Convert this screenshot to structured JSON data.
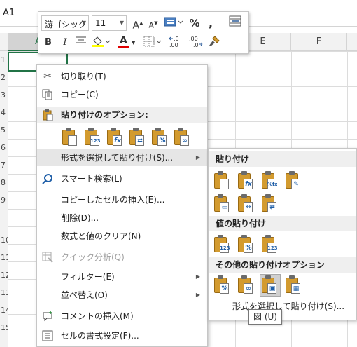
{
  "spreadsheet": {
    "name_box": "A1",
    "columns": [
      "A",
      "B",
      "C",
      "D",
      "E",
      "F"
    ],
    "rows": [
      "1",
      "2",
      "3",
      "4",
      "5",
      "6",
      "7",
      "8",
      "9",
      "10",
      "11",
      "12",
      "13",
      "14",
      "15"
    ]
  },
  "mini_toolbar": {
    "font_name": "游ゴシック",
    "font_size": "11",
    "increase_font": "A",
    "decrease_font": "A",
    "percent": "%",
    "comma": ",",
    "bold": "B",
    "italic": "I",
    "font_color_letter": "A"
  },
  "context_menu": {
    "items": [
      {
        "label": "切り取り(T)",
        "icon": "scissors-icon"
      },
      {
        "label": "コピー(C)",
        "icon": "copy-icon"
      },
      {
        "label": "貼り付けのオプション:",
        "icon": "paste-icon"
      },
      {
        "label": "形式を選択して貼り付け(S)...",
        "icon": "none"
      },
      {
        "label": "スマート検索(L)",
        "icon": "search-icon"
      },
      {
        "label": "コピーしたセルの挿入(E)...",
        "icon": "none"
      },
      {
        "label": "削除(D)...",
        "icon": "none"
      },
      {
        "label": "数式と値のクリア(N)",
        "icon": "none"
      },
      {
        "label": "クイック分析(Q)",
        "icon": "quick-analysis-icon"
      },
      {
        "label": "フィルター(E)",
        "icon": "none"
      },
      {
        "label": "並べ替え(O)",
        "icon": "none"
      },
      {
        "label": "コメントの挿入(M)",
        "icon": "comment-icon"
      },
      {
        "label": "セルの書式設定(F)...",
        "icon": "format-cells-icon"
      }
    ],
    "paste_option_marks": [
      "",
      "123",
      "fx",
      "⇄",
      "%",
      "∞"
    ]
  },
  "paste_submenu": {
    "section1": "貼り付け",
    "section1_marks_row1": [
      "",
      "fx",
      "%fx",
      "✎"
    ],
    "section1_marks_row2": [
      "▭",
      "↔",
      "⇄"
    ],
    "section2": "値の貼り付け",
    "section2_marks": [
      "123",
      "%",
      "123"
    ],
    "section3": "その他の貼り付けオプション",
    "section3_marks": [
      "%",
      "∞",
      "▣",
      "▦"
    ],
    "more_link": "形式を選択して貼り付け(S)..."
  },
  "tooltip": "図 (U)",
  "colors": {
    "accent_green": "#217346",
    "clipboard": "#d39b2f",
    "menu_highlight": "#e6e6e6"
  }
}
